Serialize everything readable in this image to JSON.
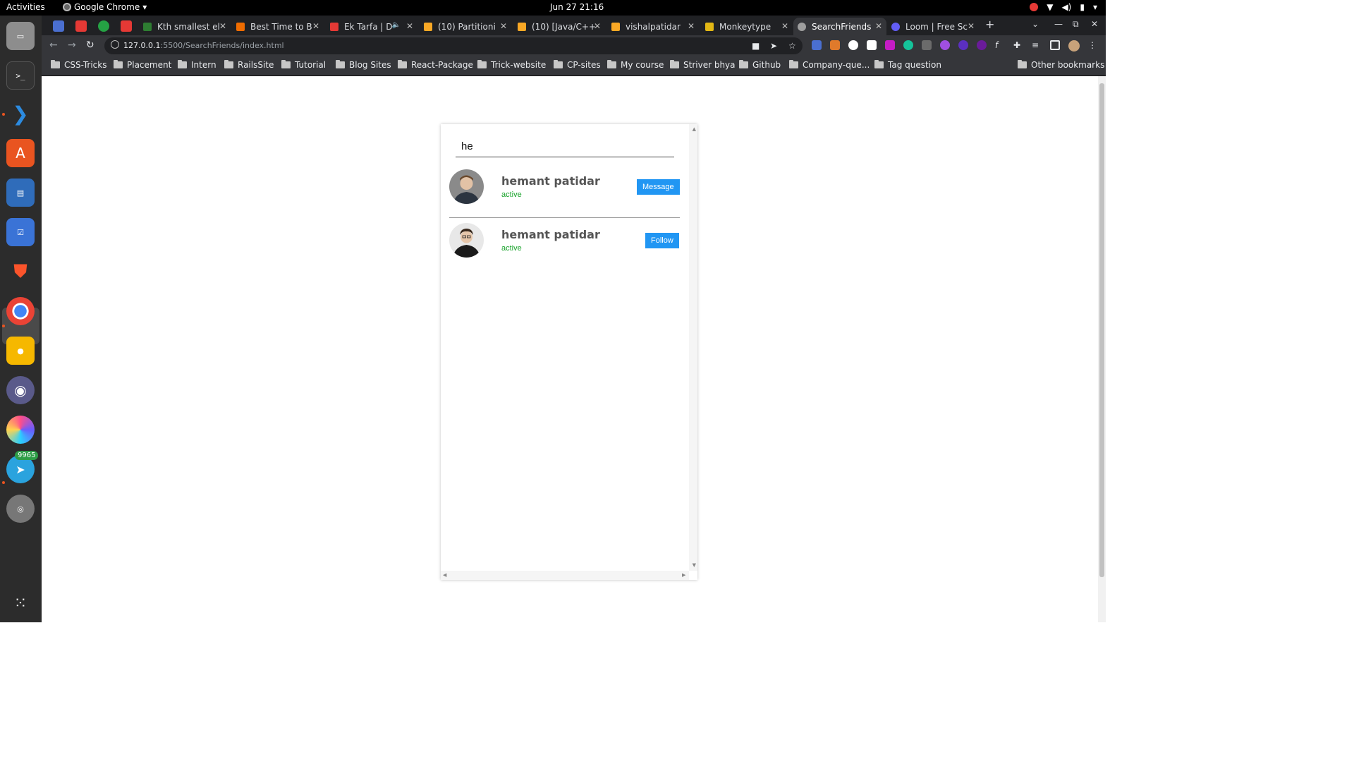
{
  "topbar": {
    "activities": "Activities",
    "app_name": "Google Chrome",
    "clock": "Jun 27  21:16"
  },
  "dock": {
    "items": [
      "files-icon",
      "terminal-icon",
      "vscode-icon",
      "software-store-icon",
      "writer-icon",
      "tasks-icon",
      "brave-icon",
      "chrome-icon",
      "notes-icon",
      "github-icon",
      "color-app-icon",
      "telegram-icon",
      "disk-icon"
    ],
    "telegram_badge": "9965"
  },
  "browser": {
    "tabs": [
      {
        "title": "Kth smallest el",
        "color": "#2e7d32"
      },
      {
        "title": "Best Time to B",
        "color": "#ef6c00"
      },
      {
        "title": "Ek Tarfa | D",
        "color": "#e53935"
      },
      {
        "title": "(10) Partitioni",
        "color": "#f9a825"
      },
      {
        "title": "(10) [Java/C++",
        "color": "#f9a825"
      },
      {
        "title": "vishalpatidar",
        "color": "#f9a825"
      },
      {
        "title": "Monkeytype",
        "color": "#e2b714"
      },
      {
        "title": "SearchFriends",
        "color": "#9e9e9e"
      },
      {
        "title": "Loom | Free Sc",
        "color": "#625df5"
      }
    ],
    "url_host": "127.0.0.1",
    "url_path": ":5500/SearchFriends/index.html",
    "bookmarks": [
      "CSS-Tricks",
      "Placement",
      "Intern",
      "RailsSite",
      "Tutorial",
      "Blog Sites",
      "React-Package",
      "Trick-website",
      "CP-sites",
      "My course",
      "Striver bhya",
      "Github",
      "Company-que...",
      "Tag question"
    ],
    "other_bookmarks": "Other bookmarks"
  },
  "app": {
    "search": {
      "value": "he"
    },
    "results": [
      {
        "name": "hemant patidar",
        "status": "active",
        "button": "Message"
      },
      {
        "name": "hemant patidar",
        "status": "active",
        "button": "Follow"
      }
    ],
    "colors": {
      "button": "#2196f3",
      "status": "#19a32b"
    }
  }
}
